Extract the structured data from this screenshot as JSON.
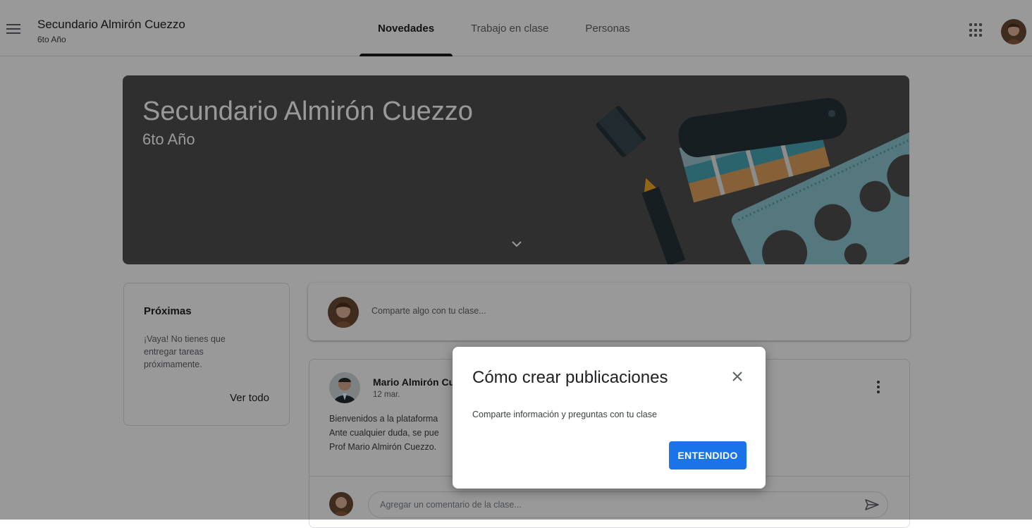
{
  "header": {
    "class_name": "Secundario Almirón Cuezzo",
    "class_section": "6to Año",
    "tabs": [
      {
        "label": "Novedades",
        "active": true
      },
      {
        "label": "Trabajo en clase",
        "active": false
      },
      {
        "label": "Personas",
        "active": false
      }
    ],
    "icons": {
      "menu": "hamburger-menu-icon",
      "apps": "apps-grid-icon",
      "account": "account-avatar"
    }
  },
  "banner": {
    "title": "Secundario Almirón Cuezzo",
    "subtitle": "6to Año",
    "background_color": "#4f4f4f"
  },
  "upcoming": {
    "title": "Próximas",
    "message": "¡Vaya! No tienes que entregar tareas próximamente.",
    "view_all": "Ver todo"
  },
  "share": {
    "placeholder": "Comparte algo con tu clase..."
  },
  "post": {
    "author": "Mario Almirón Cuezzo",
    "date": "12 mar.",
    "lines": [
      "Bienvenidos a la plataforma",
      "Ante cualquier duda, se pue",
      "Prof Mario Almirón Cuezzo."
    ],
    "comment_placeholder": "Agregar un comentario de la clase..."
  },
  "dialog": {
    "title": "Cómo crear publicaciones",
    "text": "Comparte información y preguntas con tu clase",
    "button": "ENTENDIDO"
  },
  "colors": {
    "accent": "#1a73e8",
    "banner": "#4f4f4f",
    "overlay": "rgba(0,0,0,0.40)"
  }
}
